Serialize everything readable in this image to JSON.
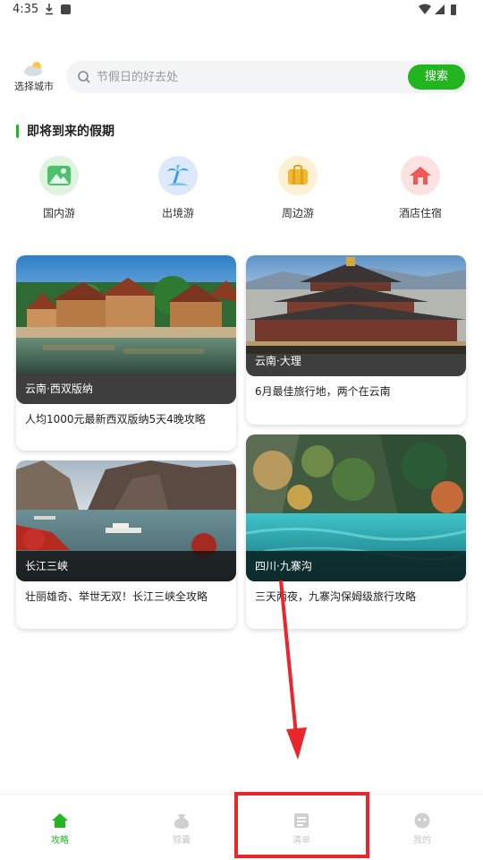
{
  "status_bar": {
    "time": "4:35"
  },
  "header": {
    "city_label": "选择城市",
    "search_placeholder": "节假日的好去处",
    "search_button": "搜索"
  },
  "section": {
    "title": "即将到来的假期"
  },
  "categories": [
    {
      "label": "国内游",
      "icon": "mountain-icon",
      "color": "#e3f5e3"
    },
    {
      "label": "出境游",
      "icon": "palm-tree-icon",
      "color": "#e2edfb"
    },
    {
      "label": "周边游",
      "icon": "suitcase-icon",
      "color": "#fdf2d9"
    },
    {
      "label": "酒店住宿",
      "icon": "house-icon",
      "color": "#fde6e6"
    }
  ],
  "cards": [
    {
      "tag": "云南·西双版纳",
      "text": "人均1000元最新西双版纳5天4晚攻略"
    },
    {
      "tag": "云南·大理",
      "text": "6月最佳旅行地，两个在云南"
    },
    {
      "tag": "长江三峡",
      "text": "壮丽雄奇、举世无双！长江三峡全攻略"
    },
    {
      "tag": "四川·九寨沟",
      "text": "三天两夜，九寨沟保姆级旅行攻略"
    }
  ],
  "bottom_nav": [
    {
      "label": "攻略",
      "active": true
    },
    {
      "label": "锦囊",
      "active": false
    },
    {
      "label": "清单",
      "active": false
    },
    {
      "label": "我的",
      "active": false
    }
  ],
  "colors": {
    "accent": "#22b51f",
    "annotation": "#e8262b"
  }
}
